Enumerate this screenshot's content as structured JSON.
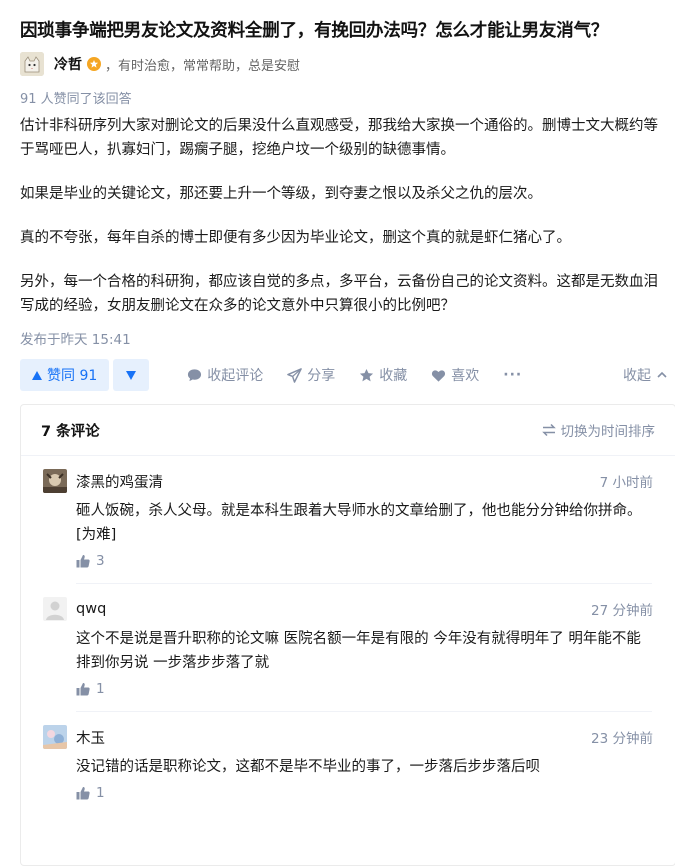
{
  "question": {
    "title": "因琐事争端把男友论文及资料全删了，有挽回办法吗？怎么才能让男友消气？"
  },
  "author": {
    "avatar_icon": "cat-avatar-icon",
    "name": "冷哲",
    "badge_icon": "excellent-badge-icon",
    "bio": "，有时治愈，常常帮助，总是安慰"
  },
  "answer": {
    "votes_line": "91 人赞同了该回答",
    "paragraphs": [
      "估计非科研序列大家对删论文的后果没什么直观感受，那我给大家换一个通俗的。删博士文大概约等于骂哑巴人，扒寡妇门，踢瘸子腿，挖绝户坟一个级别的缺德事情。",
      "如果是毕业的关键论文，那还要上升一个等级，到夺妻之恨以及杀父之仇的层次。",
      "真的不夸张，每年自杀的博士即便有多少因为毕业论文，删这个真的就是虾仁猪心了。",
      "另外，每一个合格的科研狗，都应该自觉的多点，多平台，云备份自己的论文资料。这都是无数血泪写成的经验，女朋友删论文在众多的论文意外中只算很小的比例吧？"
    ],
    "published": "发布于昨天 15:41"
  },
  "actions": {
    "upvote_label": "赞同 91",
    "collapse_comments": "收起评论",
    "share": "分享",
    "favorite": "收藏",
    "like": "喜欢",
    "more": "···",
    "collapse": "收起"
  },
  "comments": {
    "count_label": "7 条评论",
    "sort_label": "切换为时间排序",
    "items": [
      {
        "name": "漆黑的鸡蛋清",
        "time": "7 小时前",
        "text": "砸人饭碗，杀人父母。就是本科生跟着大导师水的文章给删了，他也能分分钟给你拼命。[为难]",
        "likes": "3"
      },
      {
        "name": "qwq",
        "time": "27 分钟前",
        "text": "这个不是说是晋升职称的论文嘛 医院名额一年是有限的 今年没有就得明年了 明年能不能排到你另说 一步落步步落了就",
        "likes": "1"
      },
      {
        "name": "木玉",
        "time": "23 分钟前",
        "text": "没记错的话是职称论文，这都不是毕不毕业的事了，一步落后步步落后呗",
        "likes": "1"
      }
    ]
  },
  "colors": {
    "accent": "#1772f6",
    "accent_bg": "#e6f0fd",
    "muted": "#8590a6",
    "badge": "#f5a623"
  }
}
